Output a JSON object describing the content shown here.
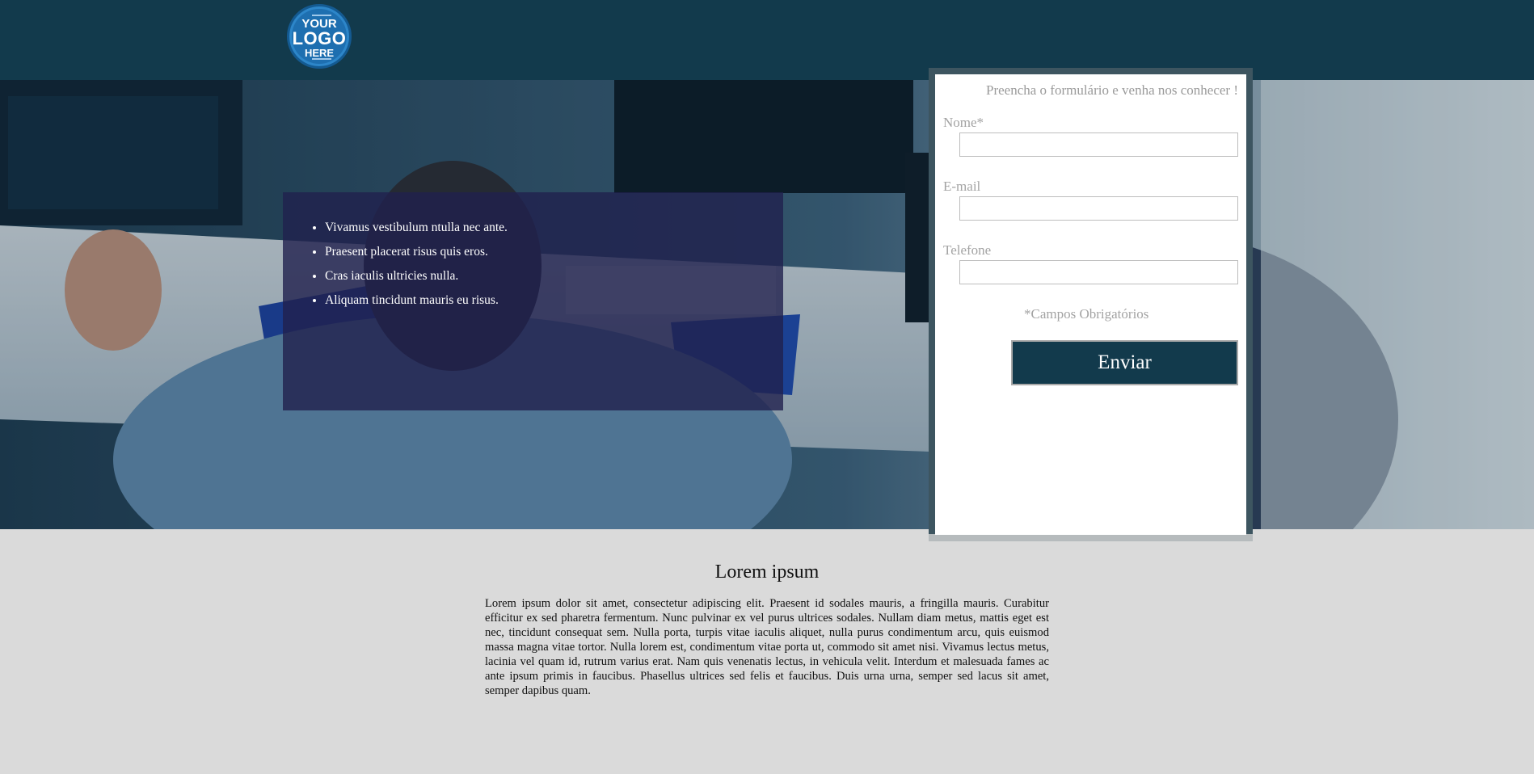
{
  "header": {
    "logo": {
      "line1": "YOUR",
      "line2": "LOGO",
      "line3": "HERE"
    }
  },
  "hero": {
    "bullets": [
      "Vivamus vestibulum ntulla nec ante.",
      "Praesent placerat risus quis eros.",
      "Cras iaculis ultricies nulla.",
      "Aliquam tincidunt mauris eu risus."
    ]
  },
  "form": {
    "title": "Preencha o formulário e venha nos conhecer !",
    "fields": [
      {
        "label": "Nome*",
        "value": ""
      },
      {
        "label": "E-mail",
        "value": ""
      },
      {
        "label": "Telefone",
        "value": ""
      }
    ],
    "required_note": "*Campos Obrigatórios",
    "submit_label": "Enviar"
  },
  "content": {
    "title": "Lorem ipsum",
    "text": "Lorem ipsum dolor sit amet, consectetur adipiscing elit. Praesent id sodales mauris, a fringilla mauris. Curabitur efficitur ex sed pharetra fermentum. Nunc pulvinar ex vel purus ultrices sodales. Nullam diam metus, mattis eget est nec, tincidunt consequat sem. Nulla porta, turpis vitae iaculis aliquet, nulla purus condimentum arcu, quis euismod massa magna vitae tortor. Nulla lorem est, condimentum vitae porta ut, commodo sit amet nisi. Vivamus lectus metus, lacinia vel quam id, rutrum varius erat. Nam quis venenatis lectus, in vehicula velit. Interdum et malesuada fames ac ante ipsum primis in faucibus. Phasellus ultrices sed felis et faucibus. Duis urna urna, semper sed lacus sit amet, semper dapibus quam."
  },
  "colors": {
    "header_bg": "#123a4c",
    "page_bg": "#dadada",
    "overlay_box": "#21214e",
    "button_bg": "#123a4c"
  }
}
